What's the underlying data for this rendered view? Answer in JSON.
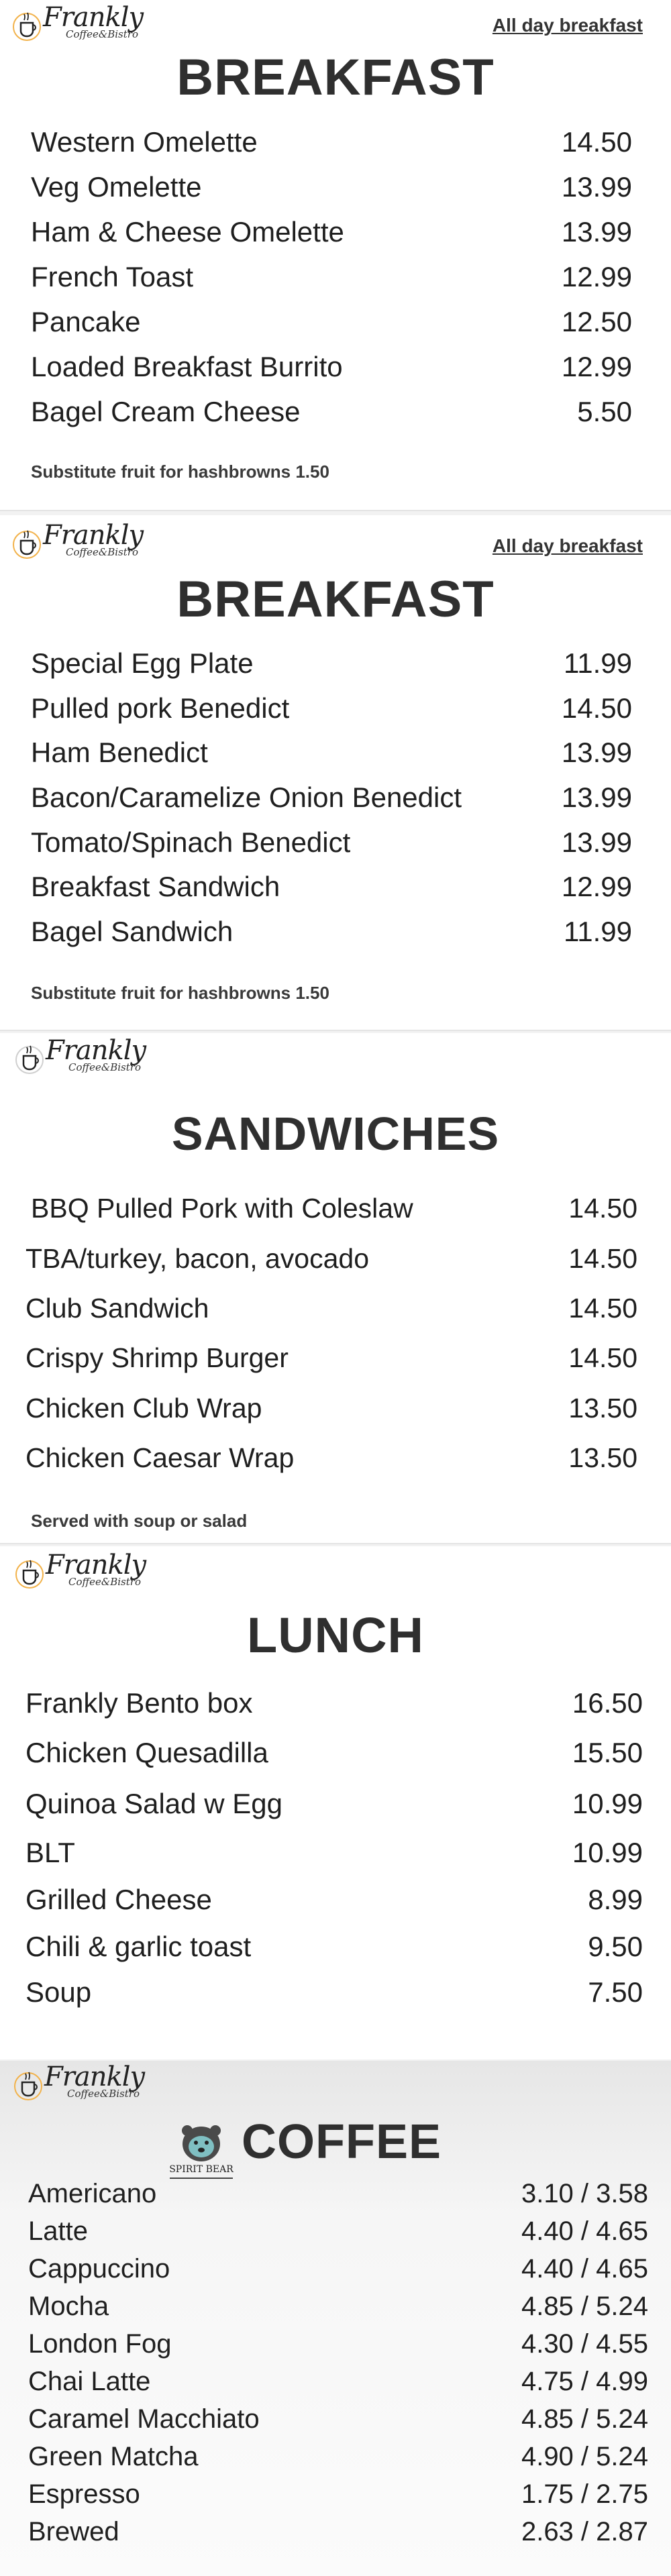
{
  "brand": {
    "name": "Frankly",
    "subtitle": "Coffee&Bistro"
  },
  "breakfast_1": {
    "tag": "All day breakfast",
    "title": "BREAKFAST",
    "items": [
      {
        "name": "Western Omelette",
        "price": "14.50"
      },
      {
        "name": "Veg Omelette",
        "price": "13.99"
      },
      {
        "name": "Ham & Cheese Omelette",
        "price": "13.99"
      },
      {
        "name": "French Toast",
        "price": "12.99"
      },
      {
        "name": "Pancake",
        "price": "12.50"
      },
      {
        "name": "Loaded Breakfast Burrito",
        "price": "12.99"
      },
      {
        "name": "Bagel Cream Cheese",
        "price": "5.50"
      }
    ],
    "note": "Substitute fruit for hashbrowns 1.50"
  },
  "breakfast_2": {
    "tag": "All day breakfast",
    "title": "BREAKFAST",
    "items": [
      {
        "name": "Special Egg Plate",
        "price": "11.99"
      },
      {
        "name": "Pulled pork Benedict",
        "price": "14.50"
      },
      {
        "name": "Ham Benedict",
        "price": "13.99"
      },
      {
        "name": "Bacon/Caramelize Onion Benedict",
        "price": "13.99"
      },
      {
        "name": "Tomato/Spinach Benedict",
        "price": "13.99"
      },
      {
        "name": "Breakfast Sandwich",
        "price": "12.99"
      },
      {
        "name": "Bagel Sandwich",
        "price": "11.99"
      }
    ],
    "note": "Substitute fruit for hashbrowns 1.50"
  },
  "sandwiches": {
    "title": "SANDWICHES",
    "items": [
      {
        "name": "BBQ Pulled Pork with Coleslaw",
        "price": "14.50"
      },
      {
        "name": "TBA/turkey, bacon, avocado",
        "price": "14.50"
      },
      {
        "name": "Club Sandwich",
        "price": "14.50"
      },
      {
        "name": "Crispy Shrimp Burger",
        "price": "14.50"
      },
      {
        "name": "Chicken Club Wrap",
        "price": "13.50"
      },
      {
        "name": "Chicken Caesar Wrap",
        "price": "13.50"
      }
    ],
    "note": "Served with soup or salad"
  },
  "lunch": {
    "title": "LUNCH",
    "items": [
      {
        "name": "Frankly Bento box",
        "price": "16.50"
      },
      {
        "name": "Chicken Quesadilla",
        "price": "15.50"
      },
      {
        "name": "Quinoa Salad w Egg",
        "price": "10.99"
      },
      {
        "name": "BLT",
        "price": "10.99"
      },
      {
        "name": "Grilled Cheese",
        "price": "8.99"
      },
      {
        "name": "Chili & garlic toast",
        "price": "9.50"
      },
      {
        "name": "Soup",
        "price": "7.50"
      }
    ]
  },
  "coffee": {
    "title": "COFFEE",
    "partner_label": "SPIRIT BEAR",
    "items": [
      {
        "name": "Americano",
        "price": "3.10 / 3.58"
      },
      {
        "name": "Latte",
        "price": "4.40 / 4.65"
      },
      {
        "name": "Cappuccino",
        "price": "4.40 / 4.65"
      },
      {
        "name": "Mocha",
        "price": "4.85 / 5.24"
      },
      {
        "name": "London Fog",
        "price": "4.30 / 4.55"
      },
      {
        "name": "Chai Latte",
        "price": "4.75 / 4.99"
      },
      {
        "name": "Caramel Macchiato",
        "price": "4.85 / 5.24"
      },
      {
        "name": "Green Matcha",
        "price": "4.90 / 5.24"
      },
      {
        "name": "Espresso",
        "price": "1.75 / 2.75"
      },
      {
        "name": "Brewed",
        "price": "2.63 / 2.87"
      }
    ]
  }
}
